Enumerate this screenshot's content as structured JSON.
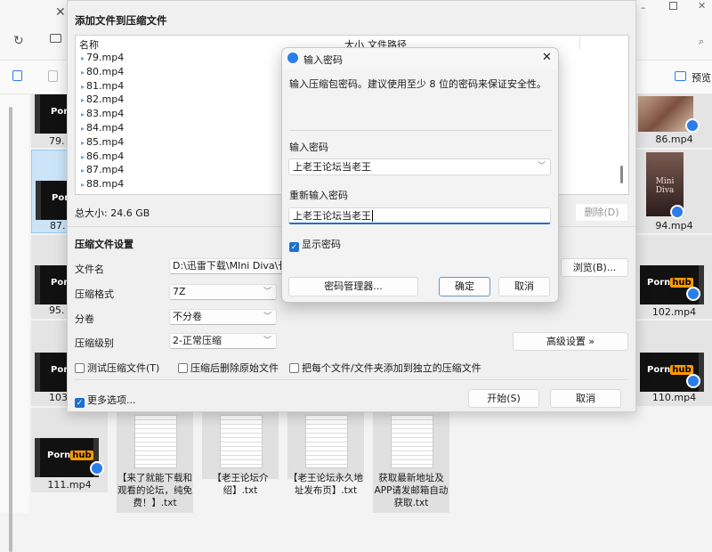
{
  "explorer": {
    "preview_label": "预览",
    "tiles_left": [
      "79.",
      "87.",
      "95.",
      "103",
      "111.mp4"
    ],
    "tiles_right": [
      "86.mp4",
      "94.mp4",
      "102.mp4",
      "110.mp4"
    ],
    "thumb_text": "Porn",
    "thumb_hub": "hub",
    "mini_diva": "Mini Diva",
    "docs": [
      "【来了就能下载和观看的论坛，纯免费！】.txt",
      "【老王论坛介绍】.txt",
      "【老王论坛永久地址发布页】.txt",
      "获取最新地址及APP请发邮箱自动获取.txt"
    ]
  },
  "archive_dialog": {
    "title": "添加文件到压缩文件",
    "columns": {
      "name": "名称",
      "size": "大小",
      "path": "文件路径"
    },
    "files": [
      "79.mp4",
      "80.mp4",
      "81.mp4",
      "82.mp4",
      "83.mp4",
      "84.mp4",
      "85.mp4",
      "86.mp4",
      "87.mp4",
      "88.mp4"
    ],
    "total_size": "总大小: 24.6 GB",
    "delete_button": "删除(D)",
    "settings_title": "压缩文件设置",
    "filename_label": "文件名",
    "filename_value": "D:\\迅雷下载\\MIni Diva\\长",
    "browse_button": "浏览(B)...",
    "format_label": "压缩格式",
    "format_value": "7Z",
    "volume_label": "分卷",
    "volume_value": "不分卷",
    "level_label": "压缩级别",
    "level_value": "2-正常压缩",
    "advanced_button": "高级设置 »",
    "test_checkbox": "测试压缩文件(T)",
    "delete_after_checkbox": "压缩后删除原始文件",
    "separate_checkbox": "把每个文件/文件夹添加到独立的压缩文件",
    "more_options": "更多选项...",
    "start_button": "开始(S)",
    "cancel_button": "取消"
  },
  "password_dialog": {
    "title": "输入密码",
    "description": "输入压缩包密码。建议使用至少 8 位的密码来保证安全性。",
    "password_label": "输入密码",
    "password_value": "上老王论坛当老王",
    "confirm_label": "重新输入密码",
    "confirm_value": "上老王论坛当老王",
    "show_password": "显示密码",
    "manager_button": "密码管理器...",
    "ok_button": "确定",
    "cancel_button": "取消"
  },
  "colors": {
    "accent": "#1e6fd0",
    "badge": "#2b7de9"
  }
}
